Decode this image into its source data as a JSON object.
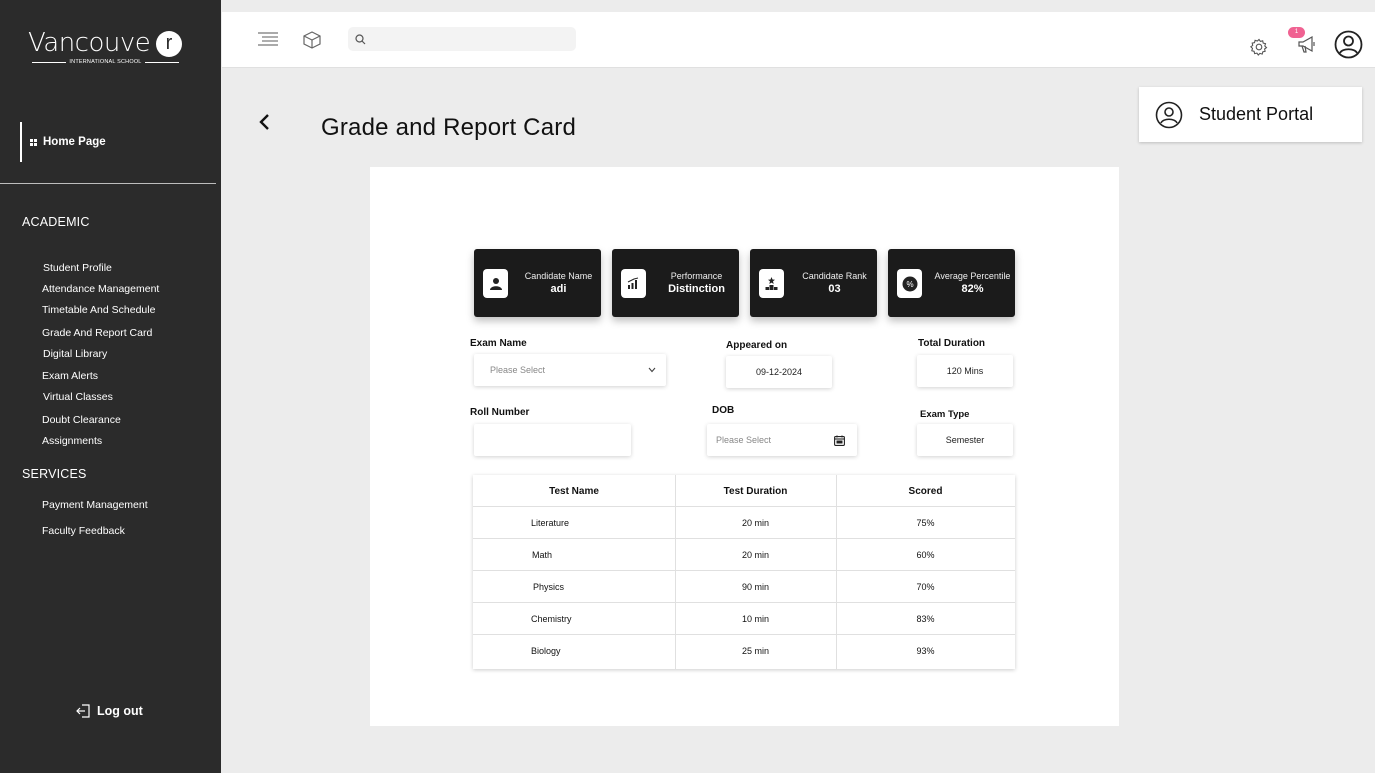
{
  "logo": {
    "word": "Vancouve",
    "r": "r",
    "sub": "INTERNATIONAL SCHOOL"
  },
  "sidebar": {
    "home": "Home Page",
    "academic_title": "ACADEMIC",
    "academic_items": [
      "Student Profile",
      "Attendance Management",
      "Timetable And Schedule",
      "Grade And Report Card",
      "Digital Library",
      "Exam Alerts",
      "Virtual Classes",
      "Doubt Clearance",
      "Assignments"
    ],
    "services_title": "SERVICES",
    "services_items": [
      "Payment Management",
      "Faculty Feedback"
    ],
    "logout": "Log out"
  },
  "header": {
    "notification_count": "1"
  },
  "page": {
    "title": "Grade and Report Card",
    "portal_label": "Student Portal"
  },
  "stats": [
    {
      "label": "Candidate Name",
      "value": "adi",
      "icon": "user-icon"
    },
    {
      "label": "Performance",
      "value": "Distinction",
      "icon": "bar-chart-icon"
    },
    {
      "label": "Candidate Rank",
      "value": "03",
      "icon": "podium-icon"
    },
    {
      "label": "Average Percentile",
      "value": "82%",
      "icon": "percent-icon"
    }
  ],
  "form": {
    "exam_name_label": "Exam Name",
    "exam_name_placeholder": "Please Select",
    "appeared_on_label": "Appeared on",
    "appeared_on_value": "09-12-2024",
    "total_duration_label": "Total Duration",
    "total_duration_value": "120 Mins",
    "roll_number_label": "Roll Number",
    "roll_number_value": "",
    "dob_label": "DOB",
    "dob_placeholder": "Please Select",
    "exam_type_label": "Exam Type",
    "exam_type_value": "Semester"
  },
  "table": {
    "headers": [
      "Test Name",
      "Test Duration",
      "Scored"
    ],
    "rows": [
      [
        "Literature",
        "20 min",
        "75%"
      ],
      [
        "Math",
        "20 min",
        "60%"
      ],
      [
        "Physics",
        "90 min",
        "70%"
      ],
      [
        "Chemistry",
        "10 min",
        "83%"
      ],
      [
        "Biology",
        "25 min",
        "93%"
      ]
    ]
  },
  "colors": {
    "sidebar": "#2b2b2b",
    "card_dark": "#1b1b1b",
    "badge": "#f06292",
    "background": "#ececec"
  }
}
